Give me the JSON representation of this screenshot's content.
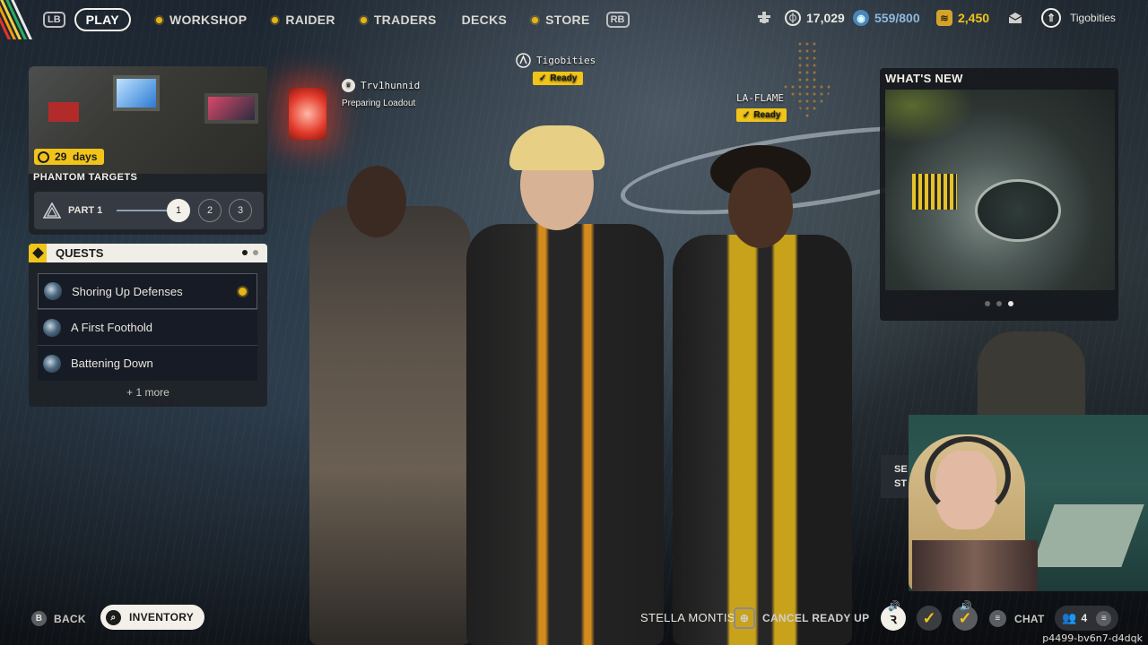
{
  "topbar": {
    "left_bumper": "LB",
    "right_bumper": "RB",
    "nav": [
      {
        "label": "PLAY",
        "active": true
      },
      {
        "label": "WORKSHOP"
      },
      {
        "label": "RAIDER"
      },
      {
        "label": "TRADERS"
      },
      {
        "label": "DECKS"
      },
      {
        "label": "STORE"
      }
    ],
    "currency": {
      "coins": "17,029",
      "raider_tokens": "559/800",
      "credits": "2,450"
    },
    "username": "Tigobities"
  },
  "season": {
    "days_left": "29",
    "days_unit": "days",
    "title": "PHANTOM TARGETS",
    "part_label": "PART 1",
    "steps": [
      "1",
      "2",
      "3"
    ],
    "active_step": 1
  },
  "quests": {
    "title": "QUESTS",
    "items": [
      {
        "name": "Shoring Up Defenses",
        "tracked": true
      },
      {
        "name": "A First Foothold",
        "tracked": false
      },
      {
        "name": "Battening Down",
        "tracked": false
      }
    ],
    "more": "+ 1 more"
  },
  "party": [
    {
      "name": "Tigobities",
      "status": "Ready"
    },
    {
      "name": "Trv1hunnid",
      "status": "Preparing Loadout"
    },
    {
      "name": "LA-FLAME",
      "status": "Ready"
    }
  ],
  "whats_new": {
    "title": "WHAT'S NEW",
    "slides": 3,
    "active_slide": 3
  },
  "side_panel": {
    "line1": "SE",
    "line2": "ST"
  },
  "bottombar": {
    "back_key": "B",
    "back_label": "BACK",
    "inventory_label": "INVENTORY",
    "location": "STELLA MONTIS",
    "cancel_label": "CANCEL READY UP",
    "chat_label": "CHAT",
    "party_count": "4"
  },
  "watermark": "p4499-bv6n7-d4dqk",
  "colors": {
    "accent_yellow": "#f0c419",
    "panel_dark": "#1e2126",
    "text_light": "#f2f0e8"
  }
}
